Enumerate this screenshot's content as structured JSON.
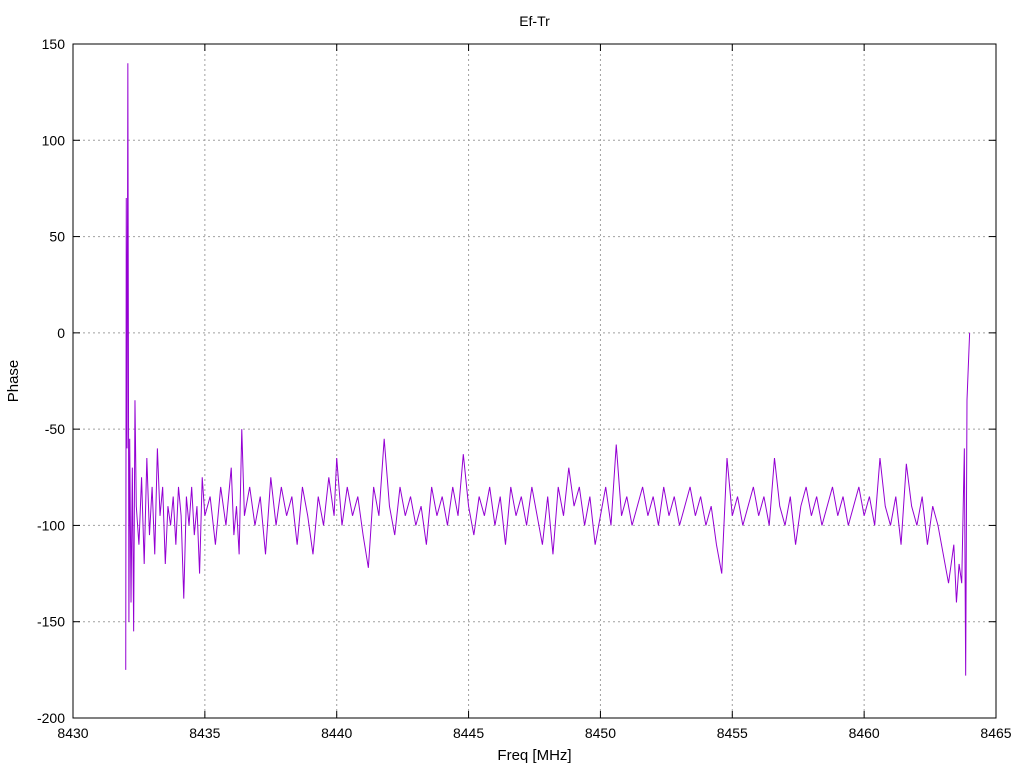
{
  "chart_data": {
    "type": "line",
    "title": "Ef-Tr",
    "xlabel": "Freq [MHz]",
    "ylabel": "Phase",
    "xlim": [
      8430,
      8465
    ],
    "ylim": [
      -200,
      150
    ],
    "xticks": [
      8430,
      8435,
      8440,
      8445,
      8450,
      8455,
      8460,
      8465
    ],
    "yticks": [
      -200,
      -150,
      -100,
      -50,
      0,
      50,
      100,
      150
    ],
    "grid": true,
    "legend": "none",
    "series": [
      {
        "color": "#9400d3",
        "points": [
          [
            8432.0,
            -175
          ],
          [
            8432.02,
            70
          ],
          [
            8432.05,
            -60
          ],
          [
            8432.08,
            140
          ],
          [
            8432.12,
            -150
          ],
          [
            8432.15,
            -55
          ],
          [
            8432.2,
            -140
          ],
          [
            8432.25,
            -70
          ],
          [
            8432.3,
            -155
          ],
          [
            8432.35,
            -35
          ],
          [
            8432.4,
            -90
          ],
          [
            8432.5,
            -110
          ],
          [
            8432.6,
            -75
          ],
          [
            8432.7,
            -120
          ],
          [
            8432.8,
            -65
          ],
          [
            8432.9,
            -105
          ],
          [
            8433.0,
            -80
          ],
          [
            8433.1,
            -115
          ],
          [
            8433.2,
            -60
          ],
          [
            8433.3,
            -95
          ],
          [
            8433.4,
            -80
          ],
          [
            8433.5,
            -120
          ],
          [
            8433.6,
            -90
          ],
          [
            8433.7,
            -100
          ],
          [
            8433.8,
            -85
          ],
          [
            8433.9,
            -110
          ],
          [
            8434.0,
            -80
          ],
          [
            8434.1,
            -95
          ],
          [
            8434.2,
            -138
          ],
          [
            8434.3,
            -85
          ],
          [
            8434.4,
            -100
          ],
          [
            8434.5,
            -80
          ],
          [
            8434.6,
            -105
          ],
          [
            8434.7,
            -90
          ],
          [
            8434.8,
            -125
          ],
          [
            8434.9,
            -75
          ],
          [
            8435.0,
            -95
          ],
          [
            8435.2,
            -85
          ],
          [
            8435.4,
            -110
          ],
          [
            8435.6,
            -80
          ],
          [
            8435.8,
            -100
          ],
          [
            8436.0,
            -70
          ],
          [
            8436.1,
            -105
          ],
          [
            8436.2,
            -90
          ],
          [
            8436.3,
            -115
          ],
          [
            8436.4,
            -50
          ],
          [
            8436.5,
            -95
          ],
          [
            8436.7,
            -80
          ],
          [
            8436.9,
            -100
          ],
          [
            8437.1,
            -85
          ],
          [
            8437.3,
            -115
          ],
          [
            8437.5,
            -75
          ],
          [
            8437.7,
            -100
          ],
          [
            8437.9,
            -80
          ],
          [
            8438.1,
            -95
          ],
          [
            8438.3,
            -85
          ],
          [
            8438.5,
            -110
          ],
          [
            8438.7,
            -80
          ],
          [
            8438.9,
            -95
          ],
          [
            8439.1,
            -115
          ],
          [
            8439.3,
            -85
          ],
          [
            8439.5,
            -100
          ],
          [
            8439.7,
            -75
          ],
          [
            8439.9,
            -95
          ],
          [
            8440.0,
            -65
          ],
          [
            8440.2,
            -100
          ],
          [
            8440.4,
            -80
          ],
          [
            8440.6,
            -95
          ],
          [
            8440.8,
            -85
          ],
          [
            8441.0,
            -105
          ],
          [
            8441.2,
            -122
          ],
          [
            8441.4,
            -80
          ],
          [
            8441.6,
            -95
          ],
          [
            8441.8,
            -55
          ],
          [
            8442.0,
            -90
          ],
          [
            8442.2,
            -105
          ],
          [
            8442.4,
            -80
          ],
          [
            8442.6,
            -95
          ],
          [
            8442.8,
            -85
          ],
          [
            8443.0,
            -100
          ],
          [
            8443.2,
            -90
          ],
          [
            8443.4,
            -110
          ],
          [
            8443.6,
            -80
          ],
          [
            8443.8,
            -95
          ],
          [
            8444.0,
            -85
          ],
          [
            8444.2,
            -100
          ],
          [
            8444.4,
            -80
          ],
          [
            8444.6,
            -95
          ],
          [
            8444.8,
            -63
          ],
          [
            8445.0,
            -90
          ],
          [
            8445.2,
            -105
          ],
          [
            8445.4,
            -85
          ],
          [
            8445.6,
            -95
          ],
          [
            8445.8,
            -80
          ],
          [
            8446.0,
            -100
          ],
          [
            8446.2,
            -85
          ],
          [
            8446.4,
            -110
          ],
          [
            8446.6,
            -80
          ],
          [
            8446.8,
            -95
          ],
          [
            8447.0,
            -85
          ],
          [
            8447.2,
            -100
          ],
          [
            8447.4,
            -80
          ],
          [
            8447.6,
            -95
          ],
          [
            8447.8,
            -110
          ],
          [
            8448.0,
            -85
          ],
          [
            8448.2,
            -115
          ],
          [
            8448.4,
            -80
          ],
          [
            8448.6,
            -95
          ],
          [
            8448.8,
            -70
          ],
          [
            8449.0,
            -90
          ],
          [
            8449.2,
            -80
          ],
          [
            8449.4,
            -100
          ],
          [
            8449.6,
            -85
          ],
          [
            8449.8,
            -110
          ],
          [
            8450.0,
            -95
          ],
          [
            8450.2,
            -80
          ],
          [
            8450.4,
            -100
          ],
          [
            8450.6,
            -58
          ],
          [
            8450.8,
            -95
          ],
          [
            8451.0,
            -85
          ],
          [
            8451.2,
            -100
          ],
          [
            8451.4,
            -90
          ],
          [
            8451.6,
            -80
          ],
          [
            8451.8,
            -95
          ],
          [
            8452.0,
            -85
          ],
          [
            8452.2,
            -100
          ],
          [
            8452.4,
            -80
          ],
          [
            8452.6,
            -95
          ],
          [
            8452.8,
            -85
          ],
          [
            8453.0,
            -100
          ],
          [
            8453.2,
            -90
          ],
          [
            8453.4,
            -80
          ],
          [
            8453.6,
            -95
          ],
          [
            8453.8,
            -85
          ],
          [
            8454.0,
            -100
          ],
          [
            8454.2,
            -90
          ],
          [
            8454.4,
            -110
          ],
          [
            8454.6,
            -125
          ],
          [
            8454.8,
            -65
          ],
          [
            8455.0,
            -95
          ],
          [
            8455.2,
            -85
          ],
          [
            8455.4,
            -100
          ],
          [
            8455.6,
            -90
          ],
          [
            8455.8,
            -80
          ],
          [
            8456.0,
            -95
          ],
          [
            8456.2,
            -85
          ],
          [
            8456.4,
            -100
          ],
          [
            8456.6,
            -65
          ],
          [
            8456.8,
            -90
          ],
          [
            8457.0,
            -100
          ],
          [
            8457.2,
            -85
          ],
          [
            8457.4,
            -110
          ],
          [
            8457.6,
            -90
          ],
          [
            8457.8,
            -80
          ],
          [
            8458.0,
            -95
          ],
          [
            8458.2,
            -85
          ],
          [
            8458.4,
            -100
          ],
          [
            8458.6,
            -90
          ],
          [
            8458.8,
            -80
          ],
          [
            8459.0,
            -95
          ],
          [
            8459.2,
            -85
          ],
          [
            8459.4,
            -100
          ],
          [
            8459.6,
            -90
          ],
          [
            8459.8,
            -80
          ],
          [
            8460.0,
            -95
          ],
          [
            8460.2,
            -85
          ],
          [
            8460.4,
            -100
          ],
          [
            8460.6,
            -65
          ],
          [
            8460.8,
            -90
          ],
          [
            8461.0,
            -100
          ],
          [
            8461.2,
            -85
          ],
          [
            8461.4,
            -110
          ],
          [
            8461.6,
            -68
          ],
          [
            8461.8,
            -90
          ],
          [
            8462.0,
            -100
          ],
          [
            8462.2,
            -85
          ],
          [
            8462.4,
            -110
          ],
          [
            8462.6,
            -90
          ],
          [
            8462.8,
            -100
          ],
          [
            8463.0,
            -115
          ],
          [
            8463.2,
            -130
          ],
          [
            8463.4,
            -110
          ],
          [
            8463.5,
            -140
          ],
          [
            8463.6,
            -120
          ],
          [
            8463.7,
            -130
          ],
          [
            8463.8,
            -60
          ],
          [
            8463.85,
            -178
          ],
          [
            8463.9,
            -35
          ],
          [
            8464.0,
            0
          ]
        ]
      }
    ]
  }
}
